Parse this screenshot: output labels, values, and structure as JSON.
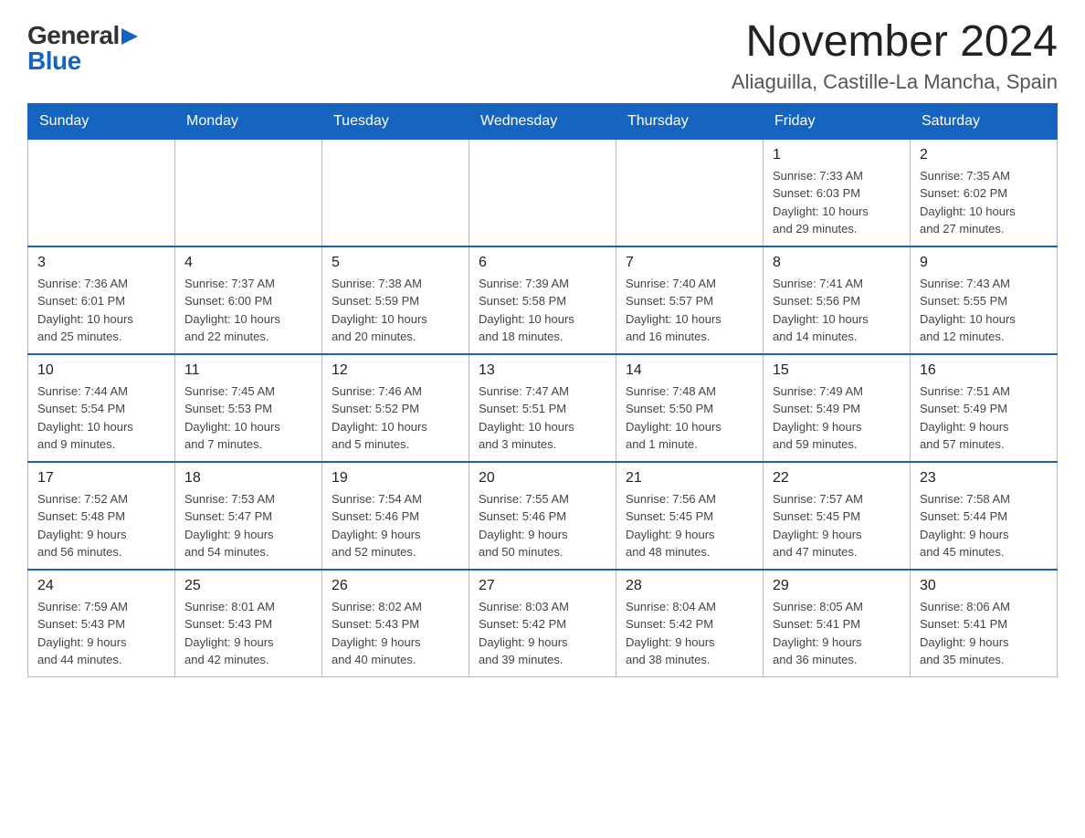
{
  "header": {
    "logo_general": "General",
    "logo_triangle": "▶",
    "logo_blue": "Blue",
    "title": "November 2024",
    "subtitle": "Aliaguilla, Castille-La Mancha, Spain"
  },
  "days_of_week": [
    "Sunday",
    "Monday",
    "Tuesday",
    "Wednesday",
    "Thursday",
    "Friday",
    "Saturday"
  ],
  "weeks": [
    {
      "days": [
        {
          "number": "",
          "info": ""
        },
        {
          "number": "",
          "info": ""
        },
        {
          "number": "",
          "info": ""
        },
        {
          "number": "",
          "info": ""
        },
        {
          "number": "",
          "info": ""
        },
        {
          "number": "1",
          "info": "Sunrise: 7:33 AM\nSunset: 6:03 PM\nDaylight: 10 hours\nand 29 minutes."
        },
        {
          "number": "2",
          "info": "Sunrise: 7:35 AM\nSunset: 6:02 PM\nDaylight: 10 hours\nand 27 minutes."
        }
      ]
    },
    {
      "days": [
        {
          "number": "3",
          "info": "Sunrise: 7:36 AM\nSunset: 6:01 PM\nDaylight: 10 hours\nand 25 minutes."
        },
        {
          "number": "4",
          "info": "Sunrise: 7:37 AM\nSunset: 6:00 PM\nDaylight: 10 hours\nand 22 minutes."
        },
        {
          "number": "5",
          "info": "Sunrise: 7:38 AM\nSunset: 5:59 PM\nDaylight: 10 hours\nand 20 minutes."
        },
        {
          "number": "6",
          "info": "Sunrise: 7:39 AM\nSunset: 5:58 PM\nDaylight: 10 hours\nand 18 minutes."
        },
        {
          "number": "7",
          "info": "Sunrise: 7:40 AM\nSunset: 5:57 PM\nDaylight: 10 hours\nand 16 minutes."
        },
        {
          "number": "8",
          "info": "Sunrise: 7:41 AM\nSunset: 5:56 PM\nDaylight: 10 hours\nand 14 minutes."
        },
        {
          "number": "9",
          "info": "Sunrise: 7:43 AM\nSunset: 5:55 PM\nDaylight: 10 hours\nand 12 minutes."
        }
      ]
    },
    {
      "days": [
        {
          "number": "10",
          "info": "Sunrise: 7:44 AM\nSunset: 5:54 PM\nDaylight: 10 hours\nand 9 minutes."
        },
        {
          "number": "11",
          "info": "Sunrise: 7:45 AM\nSunset: 5:53 PM\nDaylight: 10 hours\nand 7 minutes."
        },
        {
          "number": "12",
          "info": "Sunrise: 7:46 AM\nSunset: 5:52 PM\nDaylight: 10 hours\nand 5 minutes."
        },
        {
          "number": "13",
          "info": "Sunrise: 7:47 AM\nSunset: 5:51 PM\nDaylight: 10 hours\nand 3 minutes."
        },
        {
          "number": "14",
          "info": "Sunrise: 7:48 AM\nSunset: 5:50 PM\nDaylight: 10 hours\nand 1 minute."
        },
        {
          "number": "15",
          "info": "Sunrise: 7:49 AM\nSunset: 5:49 PM\nDaylight: 9 hours\nand 59 minutes."
        },
        {
          "number": "16",
          "info": "Sunrise: 7:51 AM\nSunset: 5:49 PM\nDaylight: 9 hours\nand 57 minutes."
        }
      ]
    },
    {
      "days": [
        {
          "number": "17",
          "info": "Sunrise: 7:52 AM\nSunset: 5:48 PM\nDaylight: 9 hours\nand 56 minutes."
        },
        {
          "number": "18",
          "info": "Sunrise: 7:53 AM\nSunset: 5:47 PM\nDaylight: 9 hours\nand 54 minutes."
        },
        {
          "number": "19",
          "info": "Sunrise: 7:54 AM\nSunset: 5:46 PM\nDaylight: 9 hours\nand 52 minutes."
        },
        {
          "number": "20",
          "info": "Sunrise: 7:55 AM\nSunset: 5:46 PM\nDaylight: 9 hours\nand 50 minutes."
        },
        {
          "number": "21",
          "info": "Sunrise: 7:56 AM\nSunset: 5:45 PM\nDaylight: 9 hours\nand 48 minutes."
        },
        {
          "number": "22",
          "info": "Sunrise: 7:57 AM\nSunset: 5:45 PM\nDaylight: 9 hours\nand 47 minutes."
        },
        {
          "number": "23",
          "info": "Sunrise: 7:58 AM\nSunset: 5:44 PM\nDaylight: 9 hours\nand 45 minutes."
        }
      ]
    },
    {
      "days": [
        {
          "number": "24",
          "info": "Sunrise: 7:59 AM\nSunset: 5:43 PM\nDaylight: 9 hours\nand 44 minutes."
        },
        {
          "number": "25",
          "info": "Sunrise: 8:01 AM\nSunset: 5:43 PM\nDaylight: 9 hours\nand 42 minutes."
        },
        {
          "number": "26",
          "info": "Sunrise: 8:02 AM\nSunset: 5:43 PM\nDaylight: 9 hours\nand 40 minutes."
        },
        {
          "number": "27",
          "info": "Sunrise: 8:03 AM\nSunset: 5:42 PM\nDaylight: 9 hours\nand 39 minutes."
        },
        {
          "number": "28",
          "info": "Sunrise: 8:04 AM\nSunset: 5:42 PM\nDaylight: 9 hours\nand 38 minutes."
        },
        {
          "number": "29",
          "info": "Sunrise: 8:05 AM\nSunset: 5:41 PM\nDaylight: 9 hours\nand 36 minutes."
        },
        {
          "number": "30",
          "info": "Sunrise: 8:06 AM\nSunset: 5:41 PM\nDaylight: 9 hours\nand 35 minutes."
        }
      ]
    }
  ]
}
